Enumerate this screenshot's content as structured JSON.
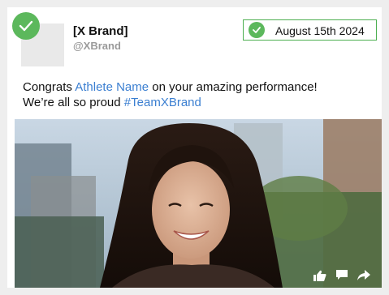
{
  "post": {
    "brand_name": "[X Brand]",
    "brand_handle": "@XBrand",
    "date": "August 15th 2024",
    "text_before": "Congrats ",
    "athlete_link": "Athlete Name",
    "text_after": " on your amazing performance!",
    "line2": "We’re all so proud ",
    "hashtag": "#TeamXBrand"
  },
  "icons": {
    "avatar_status": "check-circle-icon",
    "date_status": "check-circle-icon",
    "like": "thumbs-up-icon",
    "comment": "comment-icon",
    "share": "share-icon"
  },
  "colors": {
    "check_green": "#5cb85c",
    "link_blue": "#3b7fd1",
    "date_border": "#4caf50"
  }
}
